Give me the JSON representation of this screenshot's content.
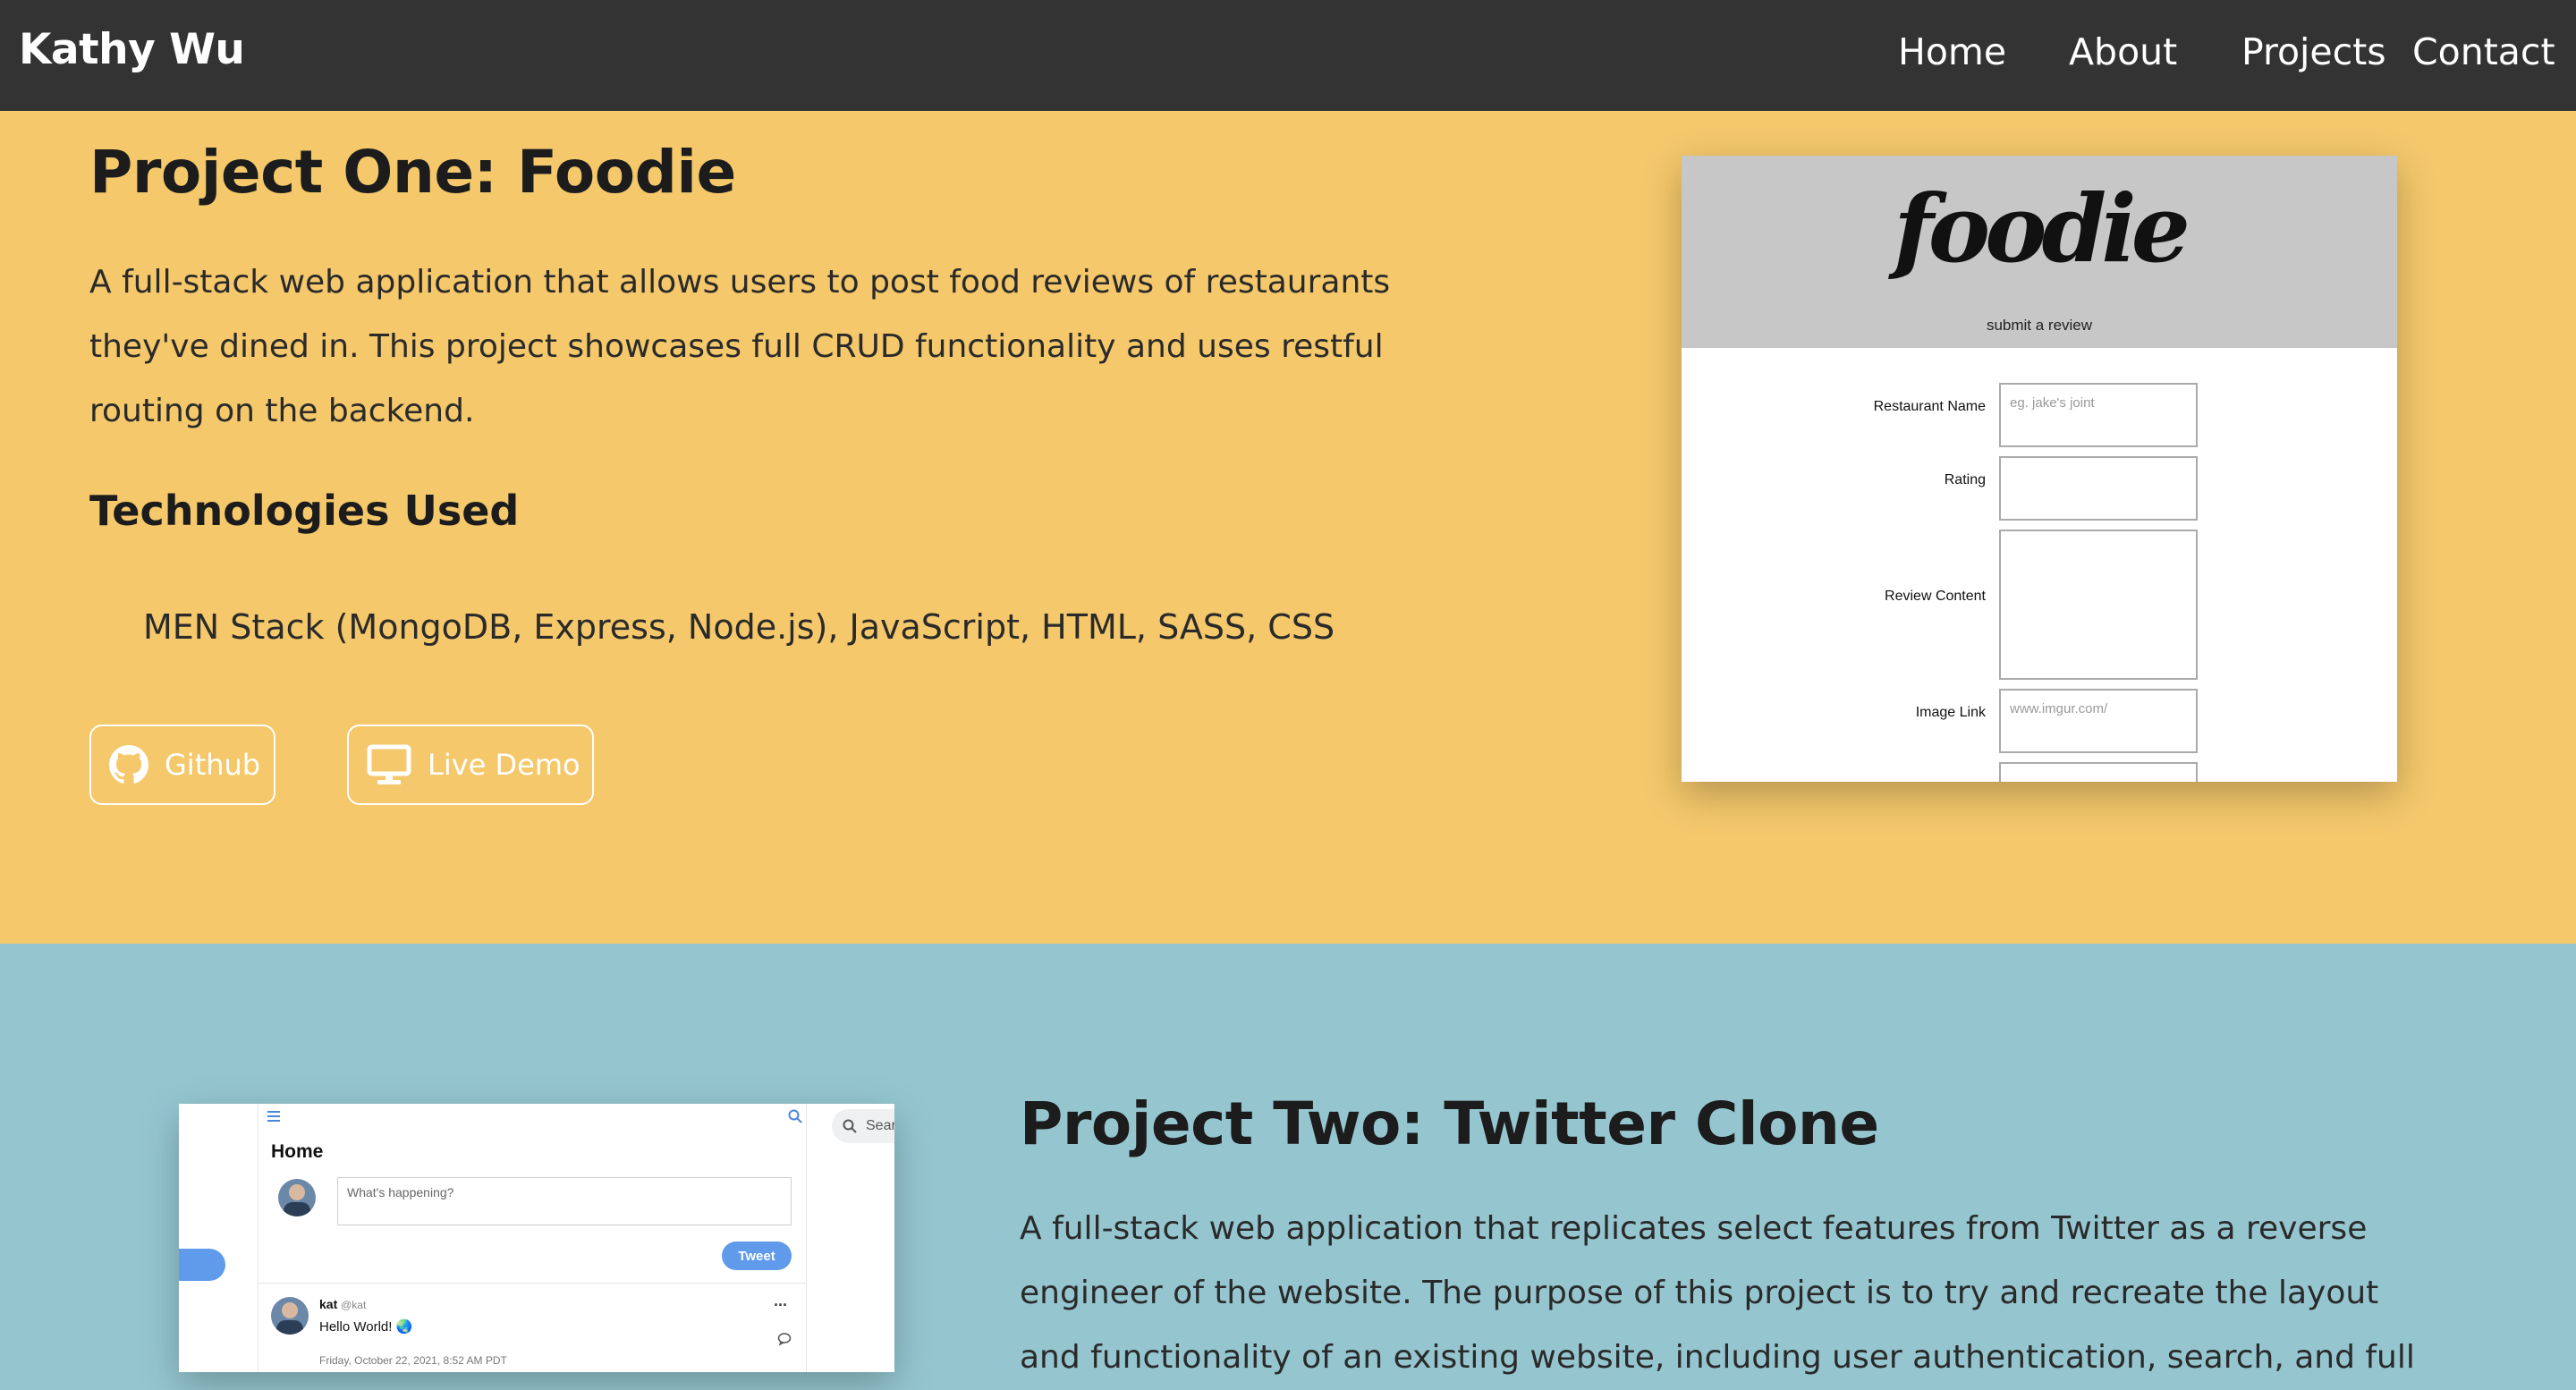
{
  "nav": {
    "brand": "Kathy Wu",
    "links": [
      "Home",
      "About",
      "Projects",
      "Contact"
    ]
  },
  "project_one": {
    "title": "Project One: Foodie",
    "description": "A full-stack web application that allows users to post food reviews of restaurants they've dined in. This project showcases full CRUD functionality and uses restful routing on the backend.",
    "tech_heading": "Technologies Used",
    "tech": "MEN Stack (MongoDB, Express, Node.js), JavaScript, HTML, SASS, CSS",
    "github_label": "Github",
    "demo_label": "Live Demo",
    "github_icon": "github-icon",
    "demo_icon": "monitor-icon",
    "screenshot": {
      "logo": "foodie",
      "subtitle": "submit a review",
      "fields": [
        {
          "label": "Restaurant Name",
          "placeholder": "eg. jake's joint"
        },
        {
          "label": "Rating",
          "placeholder": ""
        },
        {
          "label": "Review Content",
          "placeholder": ""
        },
        {
          "label": "Image Link",
          "placeholder": "www.imgur.com/"
        }
      ]
    }
  },
  "project_two": {
    "title": "Project Two: Twitter Clone",
    "description": "A full-stack web application that replicates select features from Twitter as a reverse engineer of the website. The purpose of this project is to try and recreate the layout and functionality of an existing website, including user authentication, search, and full",
    "screenshot": {
      "home_label": "Home",
      "compose_placeholder": "What's happening?",
      "tweet_button": "Tweet",
      "search_text": "Sear",
      "tweet_user": "kat",
      "tweet_handle": "@kat",
      "tweet_text": "Hello World! 🌏",
      "tweet_date": "Friday, October 22, 2021, 8:52 AM PDT",
      "more_text": "..."
    }
  },
  "colors": {
    "nav": "#333333",
    "section_one": "#f4c86b",
    "section_two": "#95c6d0",
    "tweet_blue": "#5f9bea"
  }
}
